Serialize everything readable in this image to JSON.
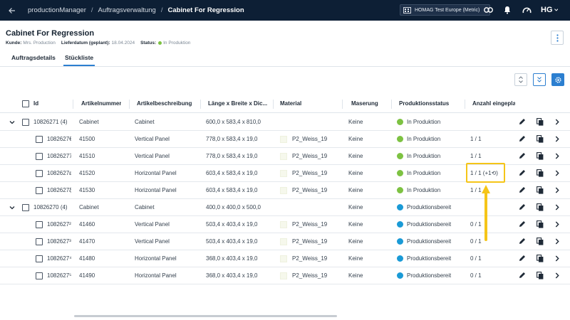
{
  "topbar": {
    "breadcrumbs": [
      "productionManager",
      "Auftragsverwaltung",
      "Cabinet For Regression"
    ],
    "separator": "/",
    "org_label": "HOMAG Test Europe (Metric)",
    "logo_text": "HG"
  },
  "header": {
    "title": "Cabinet For Regression",
    "kunde_label": "Kunde:",
    "kunde_value": "Mrs. Production",
    "lieferdatum_label": "Lieferdatum (geplant):",
    "lieferdatum_value": "18.04.2024",
    "status_label": "Status:",
    "status_value": "In Produktion"
  },
  "tabs": [
    "Auftragsdetails",
    "Stückliste"
  ],
  "active_tab": "Stückliste",
  "columns": [
    "Id",
    "Artikelnummer",
    "Artikelbeschreibung",
    "Länge x Breite x Dic...",
    "Material",
    "Maserung",
    "Produktionsstatus",
    "Anzahl eingepla"
  ],
  "status_colors": {
    "In Produktion": "#7dc242",
    "Produktionsbereit": "#1a9ad6"
  },
  "accent_color": "#2c7fd0",
  "highlight_color": "#f5c518",
  "rows": [
    {
      "type": "group",
      "id": "10826271 (4)",
      "artikelnummer": "Cabinet",
      "beschreibung": "Cabinet",
      "masse": "600,0 x 583,4 x 810,0",
      "material": "",
      "maserung": "Keine",
      "status": "In Produktion",
      "anzahl": ""
    },
    {
      "type": "child",
      "id": "1082627€",
      "artikelnummer": "41500",
      "beschreibung": "Vertical Panel",
      "masse": "778,0 x 583,4 x 19,0",
      "material": "P2_Weiss_19",
      "maserung": "Keine",
      "status": "In Produktion",
      "anzahl": "1 / 1"
    },
    {
      "type": "child",
      "id": "10826277",
      "artikelnummer": "41510",
      "beschreibung": "Vertical Panel",
      "masse": "778,0 x 583,4 x 19,0",
      "material": "P2_Weiss_19",
      "maserung": "Keine",
      "status": "In Produktion",
      "anzahl": "1 / 1"
    },
    {
      "type": "child",
      "id": "1082627ε",
      "artikelnummer": "41520",
      "beschreibung": "Horizontal Panel",
      "masse": "603,4 x 583,4 x 19,0",
      "material": "P2_Weiss_19",
      "maserung": "Keine",
      "status": "In Produktion",
      "anzahl": "1 / 1  (+1⟲)"
    },
    {
      "type": "child",
      "id": "1082627ξ",
      "artikelnummer": "41530",
      "beschreibung": "Horizontal Panel",
      "masse": "603,4 x 583,4 x 19,0",
      "material": "P2_Weiss_19",
      "maserung": "Keine",
      "status": "In Produktion",
      "anzahl": "1 / 1"
    },
    {
      "type": "group",
      "id": "10826270 (4)",
      "artikelnummer": "Cabinet",
      "beschreibung": "Cabinet",
      "masse": "400,0 x 400,0 x 500,0",
      "material": "",
      "maserung": "Keine",
      "status": "Produktionsbereit",
      "anzahl": ""
    },
    {
      "type": "child",
      "id": "1082627²",
      "artikelnummer": "41460",
      "beschreibung": "Vertical Panel",
      "masse": "503,4 x 403,4 x 19,0",
      "material": "P2_Weiss_19",
      "maserung": "Keine",
      "status": "Produktionsbereit",
      "anzahl": "0 / 1"
    },
    {
      "type": "child",
      "id": "1082627³",
      "artikelnummer": "41470",
      "beschreibung": "Vertical Panel",
      "masse": "503,4 x 403,4 x 19,0",
      "material": "P2_Weiss_19",
      "maserung": "Keine",
      "status": "Produktionsbereit",
      "anzahl": "0 / 1"
    },
    {
      "type": "child",
      "id": "1082627⁴",
      "artikelnummer": "41480",
      "beschreibung": "Horizontal Panel",
      "masse": "368,0 x 403,4 x 19,0",
      "material": "P2_Weiss_19",
      "maserung": "Keine",
      "status": "Produktionsbereit",
      "anzahl": "0 / 1"
    },
    {
      "type": "child",
      "id": "1082627⁵",
      "artikelnummer": "41490",
      "beschreibung": "Horizontal Panel",
      "masse": "368,0 x 403,4 x 19,0",
      "material": "P2_Weiss_19",
      "maserung": "Keine",
      "status": "Produktionsbereit",
      "anzahl": "0 / 1"
    }
  ]
}
